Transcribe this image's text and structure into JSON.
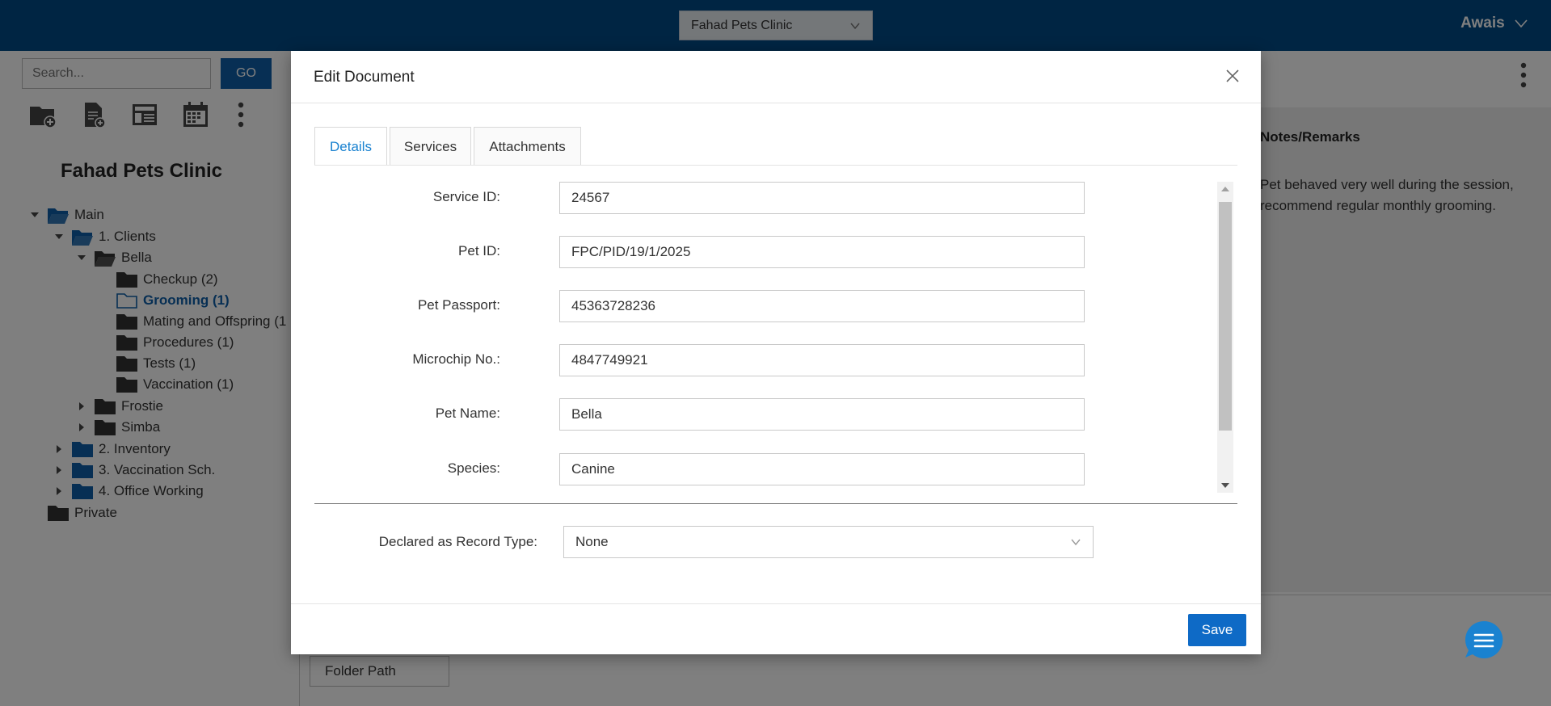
{
  "header": {
    "clinic_selected": "Fahad Pets Clinic",
    "user_name": "Awais"
  },
  "left_panel": {
    "search_placeholder": "Search...",
    "go_label": "GO",
    "toolbar_icons": [
      "new-folder-icon",
      "new-document-icon",
      "template-icon",
      "calendar-icon",
      "more-vertical-icon"
    ],
    "title": "Fahad Pets Clinic",
    "tree": {
      "main": "Main",
      "clients": "1. Clients",
      "bella": "Bella",
      "checkup": "Checkup (2)",
      "grooming": "Grooming (1)",
      "mating": "Mating and Offspring (1",
      "procedures": "Procedures (1)",
      "tests": "Tests (1)",
      "vaccination": "Vaccination (1)",
      "frostie": "Frostie",
      "simba": "Simba",
      "inventory": "2. Inventory",
      "vaccination_sch": "3. Vaccination Sch.",
      "office_working": "4. Office Working",
      "private": "Private"
    }
  },
  "right_panel": {
    "notes_header": "Notes/Remarks",
    "notes_text": "Pet behaved very well during the session, recommend regular monthly grooming."
  },
  "background": {
    "folder_path_label": "Folder Path"
  },
  "modal": {
    "title": "Edit Document",
    "tabs": [
      "Details",
      "Services",
      "Attachments"
    ],
    "active_tab": "Details",
    "fields": [
      {
        "label": "Service ID:",
        "value": "24567"
      },
      {
        "label": "Pet ID:",
        "value": "FPC/PID/19/1/2025"
      },
      {
        "label": "Pet Passport:",
        "value": "45363728236"
      },
      {
        "label": "Microchip No.:",
        "value": "4847749921"
      },
      {
        "label": "Pet Name:",
        "value": "Bella"
      },
      {
        "label": "Species:",
        "value": "Canine"
      }
    ],
    "record_type_label": "Declared as Record Type:",
    "record_type_value": "None",
    "save_label": "Save"
  },
  "colors": {
    "topbar": "#004a87",
    "accent": "#0e6ac6",
    "folder_blue": "#0e5fa8",
    "folder_dark": "#333333"
  }
}
